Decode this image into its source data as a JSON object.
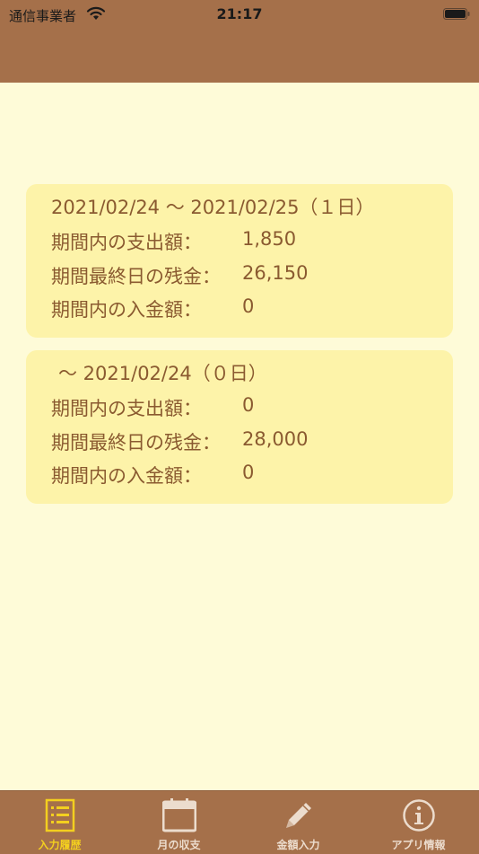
{
  "status_bar": {
    "carrier": "通信事業者",
    "time": "21:17"
  },
  "periods": [
    {
      "header": "2021/02/24 〜 2021/02/25（１日）",
      "spent_label": "期間内の支出額：",
      "spent_value": "1,850",
      "balance_label": "期間最終日の残金：",
      "balance_value": "26,150",
      "income_label": "期間内の入金額：",
      "income_value": "0"
    },
    {
      "header": "〜 2021/02/24（０日）",
      "spent_label": "期間内の支出額：",
      "spent_value": "0",
      "balance_label": "期間最終日の残金：",
      "balance_value": "28,000",
      "income_label": "期間内の入金額：",
      "income_value": "0"
    }
  ],
  "tabs": [
    {
      "label": "入力履歴",
      "icon": "list-icon",
      "active": true
    },
    {
      "label": "月の収支",
      "icon": "calendar-icon",
      "active": false
    },
    {
      "label": "金額入力",
      "icon": "pencil-icon",
      "active": false
    },
    {
      "label": "アプリ情報",
      "icon": "info-icon",
      "active": false
    }
  ],
  "colors": {
    "bar": "#a5704a",
    "background": "#fefbd8",
    "card": "#fdf3a9",
    "text": "#8a5a30",
    "active_tab": "#f3cf1f",
    "inactive_tab": "#ecdccd"
  }
}
